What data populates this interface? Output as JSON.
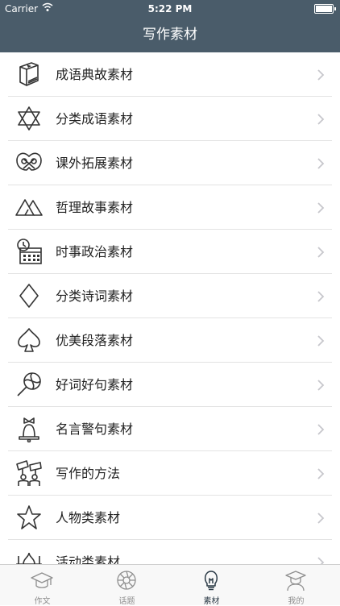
{
  "status_bar": {
    "carrier": "Carrier",
    "time": "5:22 PM"
  },
  "navbar": {
    "title": "写作素材"
  },
  "list": {
    "items": [
      {
        "label": "成语典故素材",
        "icon": "book-icon"
      },
      {
        "label": "分类成语素材",
        "icon": "star-of-david-icon"
      },
      {
        "label": "课外拓展素材",
        "icon": "pretzel-icon"
      },
      {
        "label": "哲理故事素材",
        "icon": "mountains-icon"
      },
      {
        "label": "时事政治素材",
        "icon": "calendar-clock-icon"
      },
      {
        "label": "分类诗词素材",
        "icon": "diamond-icon"
      },
      {
        "label": "优美段落素材",
        "icon": "spade-icon"
      },
      {
        "label": "好词好句素材",
        "icon": "lollipop-icon"
      },
      {
        "label": "名言警句素材",
        "icon": "bell-icon"
      },
      {
        "label": "写作的方法",
        "icon": "protest-sign-icon"
      },
      {
        "label": "人物类素材",
        "icon": "star-icon"
      },
      {
        "label": "活动类素材",
        "icon": "mosque-icon"
      }
    ]
  },
  "tabbar": {
    "tabs": [
      {
        "label": "作文",
        "icon": "graduation-cap-icon"
      },
      {
        "label": "话题",
        "icon": "aperture-icon"
      },
      {
        "label": "素材",
        "icon": "lightbulb-icon"
      },
      {
        "label": "我的",
        "icon": "graduate-avatar-icon"
      }
    ],
    "active_index": 2
  },
  "colors": {
    "nav_bg": "#4a5c6a",
    "text": "#222222",
    "chevron": "#c7c7cc",
    "tab_inactive": "#8e8e8e",
    "tab_active": "#2b3a46"
  }
}
